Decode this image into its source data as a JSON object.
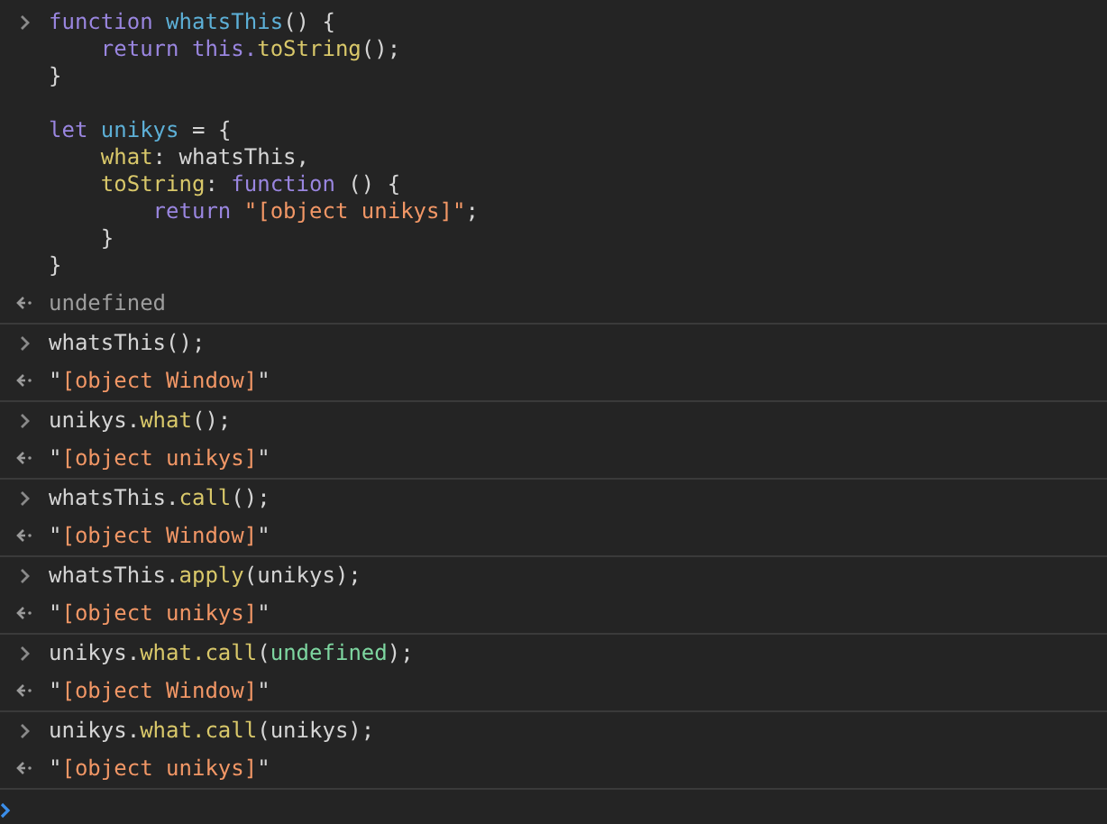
{
  "console": {
    "entries": [
      {
        "input": [
          {
            "tokens": [
              {
                "kind": "keyword",
                "text": "function "
              },
              {
                "kind": "def",
                "text": "whatsThis"
              },
              {
                "kind": "plain",
                "text": "() {"
              }
            ]
          },
          {
            "tokens": [
              {
                "kind": "keyword",
                "text": "    return this."
              },
              {
                "kind": "property",
                "text": "toString"
              },
              {
                "kind": "plain",
                "text": "();"
              }
            ]
          },
          {
            "tokens": [
              {
                "kind": "plain",
                "text": "}"
              }
            ]
          },
          {
            "kind": "blank"
          },
          {
            "tokens": [
              {
                "kind": "keyword",
                "text": "let "
              },
              {
                "kind": "def",
                "text": "unikys"
              },
              {
                "kind": "plain",
                "text": " = {"
              }
            ]
          },
          {
            "tokens": [
              {
                "kind": "property",
                "text": "    what"
              },
              {
                "kind": "plain",
                "text": ": whatsThis,"
              }
            ]
          },
          {
            "tokens": [
              {
                "kind": "property",
                "text": "    toString"
              },
              {
                "kind": "plain",
                "text": ": "
              },
              {
                "kind": "keyword",
                "text": "function"
              },
              {
                "kind": "plain",
                "text": " () {"
              }
            ]
          },
          {
            "tokens": [
              {
                "kind": "keyword",
                "text": "        return "
              },
              {
                "kind": "string",
                "text": "\"[object unikys]\""
              },
              {
                "kind": "plain",
                "text": ";"
              }
            ]
          },
          {
            "tokens": [
              {
                "kind": "plain",
                "text": "    }"
              }
            ]
          },
          {
            "tokens": [
              {
                "kind": "plain",
                "text": "}"
              }
            ]
          }
        ],
        "output": [
          {
            "kind": "undefined",
            "text": "undefined"
          }
        ]
      },
      {
        "input": [
          {
            "tokens": [
              {
                "kind": "plain",
                "text": "whatsThis();"
              }
            ]
          }
        ],
        "output": [
          {
            "kind": "plain",
            "text": "\""
          },
          {
            "kind": "string",
            "text": "[object Window]"
          },
          {
            "kind": "plain",
            "text": "\""
          }
        ]
      },
      {
        "input": [
          {
            "tokens": [
              {
                "kind": "plain",
                "text": "unikys."
              },
              {
                "kind": "property",
                "text": "what"
              },
              {
                "kind": "plain",
                "text": "();"
              }
            ]
          }
        ],
        "output": [
          {
            "kind": "plain",
            "text": "\""
          },
          {
            "kind": "string",
            "text": "[object unikys]"
          },
          {
            "kind": "plain",
            "text": "\""
          }
        ]
      },
      {
        "input": [
          {
            "tokens": [
              {
                "kind": "plain",
                "text": "whatsThis."
              },
              {
                "kind": "property",
                "text": "call"
              },
              {
                "kind": "plain",
                "text": "();"
              }
            ]
          }
        ],
        "output": [
          {
            "kind": "plain",
            "text": "\""
          },
          {
            "kind": "string",
            "text": "[object Window]"
          },
          {
            "kind": "plain",
            "text": "\""
          }
        ]
      },
      {
        "input": [
          {
            "tokens": [
              {
                "kind": "plain",
                "text": "whatsThis."
              },
              {
                "kind": "property",
                "text": "apply"
              },
              {
                "kind": "plain",
                "text": "(unikys);"
              }
            ]
          }
        ],
        "output": [
          {
            "kind": "plain",
            "text": "\""
          },
          {
            "kind": "string",
            "text": "[object unikys]"
          },
          {
            "kind": "plain",
            "text": "\""
          }
        ]
      },
      {
        "input": [
          {
            "tokens": [
              {
                "kind": "plain",
                "text": "unikys."
              },
              {
                "kind": "property",
                "text": "what."
              },
              {
                "kind": "property",
                "text": "call"
              },
              {
                "kind": "plain",
                "text": "("
              },
              {
                "kind": "literal",
                "text": "undefined"
              },
              {
                "kind": "plain",
                "text": ");"
              }
            ]
          }
        ],
        "output": [
          {
            "kind": "plain",
            "text": "\""
          },
          {
            "kind": "string",
            "text": "[object Window]"
          },
          {
            "kind": "plain",
            "text": "\""
          }
        ]
      },
      {
        "input": [
          {
            "tokens": [
              {
                "kind": "plain",
                "text": "unikys."
              },
              {
                "kind": "property",
                "text": "what."
              },
              {
                "kind": "property",
                "text": "call"
              },
              {
                "kind": "plain",
                "text": "(unikys);"
              }
            ]
          }
        ],
        "output": [
          {
            "kind": "plain",
            "text": "\""
          },
          {
            "kind": "string",
            "text": "[object unikys]"
          },
          {
            "kind": "plain",
            "text": "\""
          }
        ]
      }
    ]
  }
}
